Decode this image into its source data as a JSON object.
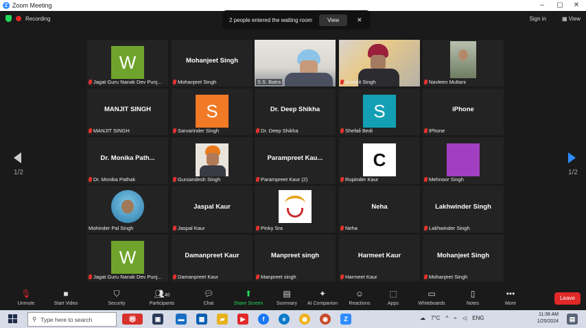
{
  "window": {
    "title": "Zoom Meeting",
    "min": "–",
    "max": "▢",
    "close": "✕"
  },
  "status": {
    "recording": "Recording"
  },
  "waiting": {
    "message": "2 people entered the waiting room",
    "view": "View",
    "close": "✕"
  },
  "top_right": {
    "sign_in": "Sign in",
    "view": "View"
  },
  "pager": {
    "left": "1/2",
    "right": "1/2"
  },
  "tiles": [
    {
      "label": "Jagat Guru Nanak Dev Punj...",
      "avatar": "W",
      "avatar_color": "#6fa42c"
    },
    {
      "label": "Mohanjeet Singh",
      "name": "Mohanjeet Singh"
    },
    {
      "label": "S.S. Batra"
    },
    {
      "label": "Amarjit Singh"
    },
    {
      "label": "Navleen Multani"
    },
    {
      "label": "MANJIT SINGH",
      "name": "MANJIT SINGH"
    },
    {
      "label": "Sarvarinder Singh",
      "avatar": "S",
      "avatar_color": "#f07a26"
    },
    {
      "label": "Dr. Deep Shikha",
      "name": "Dr. Deep Shikha"
    },
    {
      "label": "Shefali Bedi",
      "avatar": "S",
      "avatar_color": "#14a0b4"
    },
    {
      "label": "iPhone",
      "name": "iPhone"
    },
    {
      "label": "Dr. Monika Pathak",
      "name": "Dr. Monika Path..."
    },
    {
      "label": "Gursandesh Singh"
    },
    {
      "label": "Parampreet Kaur (2)",
      "name": "Parampreet  Kau..."
    },
    {
      "label": "Rupinder Kaur"
    },
    {
      "label": "Mehnoor Singh",
      "avatar_color": "#a23fc1"
    },
    {
      "label": "Mohinder Pal Singh"
    },
    {
      "label": "Jaspal Kaur",
      "name": "Jaspal Kaur"
    },
    {
      "label": "Pinky Sra"
    },
    {
      "label": "Neha",
      "name": "Neha"
    },
    {
      "label": "Lakhwinder Singh",
      "name": "Lakhwinder Singh"
    },
    {
      "label": "Jagat Guru Nanak Dev Punj...",
      "avatar": "W",
      "avatar_color": "#6fa42c"
    },
    {
      "label": "Damanpreet Kaur",
      "name": "Damanpreet Kaur"
    },
    {
      "label": "Manpreet  singh",
      "name": "Manpreet  singh"
    },
    {
      "label": "Harmeet Kaur",
      "name": "Harmeet Kaur"
    },
    {
      "label": "Mohanjeet Singh",
      "name": "Mohanjeet Singh"
    }
  ],
  "toolbar": {
    "unmute": "Unmute",
    "video": "Start Video",
    "security": "Security",
    "participants": "Participants",
    "participants_count": "40",
    "chat": "Chat",
    "share": "Share Screen",
    "summary": "Summary",
    "ai": "AI Companion",
    "reactions": "Reactions",
    "apps": "Apps",
    "whiteboards": "Whiteboards",
    "notes": "Notes",
    "more": "More",
    "leave": "Leave"
  },
  "taskbar": {
    "search_placeholder": "Type here to search",
    "weather": "7°C",
    "lang": "ENG",
    "time": "11:38 AM",
    "date": "1/25/2024"
  },
  "colors": {
    "recording": "#e02828",
    "shield": "#23d959",
    "leave": "#e02828",
    "share": "#23d959",
    "active_speaker": "#d8e81c"
  }
}
